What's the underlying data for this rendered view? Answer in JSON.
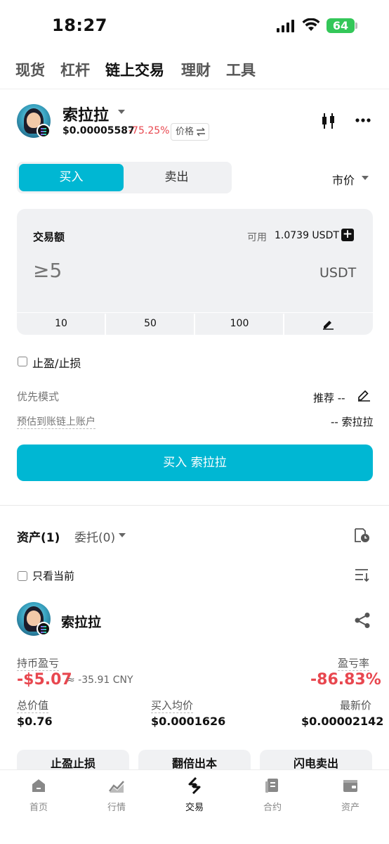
{
  "status_bar": {
    "time": "18:27",
    "battery": "64"
  },
  "top_tabs": [
    {
      "label": "现货",
      "active": false
    },
    {
      "label": "杠杆",
      "active": false
    },
    {
      "label": "链上交易",
      "active": true
    },
    {
      "label": "理财",
      "active": false
    },
    {
      "label": "工具",
      "active": false
    }
  ],
  "token": {
    "name": "索拉拉",
    "price": "$0.00005587",
    "change": "-75.25%",
    "price_toggle": "价格"
  },
  "trade": {
    "buy_label": "买入",
    "sell_label": "卖出",
    "order_type": "市价",
    "panel_title": "交易额",
    "available_label": "可用",
    "available_value": "1.0739 USDT",
    "amount_placeholder": "≥5",
    "amount_unit": "USDT",
    "quick_amounts": [
      "10",
      "50",
      "100"
    ],
    "tp_sl_label": "止盈/止损",
    "priority_label": "优先模式",
    "priority_value": "推荐 --",
    "estimate_label": "预估到账链上账户",
    "estimate_value": "-- 索拉拉",
    "submit_label": "买入 索拉拉"
  },
  "holdings": {
    "assets_tab": "资产(1)",
    "orders_tab": "委托(0)",
    "only_current": "只看当前",
    "token_name": "索拉拉",
    "pnl_label": "持币盈亏",
    "pnl_value": "-$5.07",
    "pnl_cny": "≈ -35.91 CNY",
    "pnl_rate_label": "盈亏率",
    "pnl_rate_value": "-86.83%",
    "total_value_label": "总价值",
    "total_value": "$0.76",
    "avg_buy_label": "买入均价",
    "avg_buy_value": "$0.0001626",
    "latest_price_label": "最新价",
    "latest_price_value": "$0.00002142",
    "actions": [
      "止盈止损",
      "翻倍出本",
      "闪电卖出"
    ]
  },
  "bottom_nav": [
    {
      "label": "首页",
      "icon": "home-icon",
      "active": false
    },
    {
      "label": "行情",
      "icon": "market-icon",
      "active": false
    },
    {
      "label": "交易",
      "icon": "trade-icon",
      "active": true
    },
    {
      "label": "合约",
      "icon": "contract-icon",
      "active": false
    },
    {
      "label": "资产",
      "icon": "wallet-icon",
      "active": false
    }
  ],
  "colors": {
    "accent": "#00b7d3",
    "negative": "#e8474f",
    "battery": "#34c759"
  }
}
